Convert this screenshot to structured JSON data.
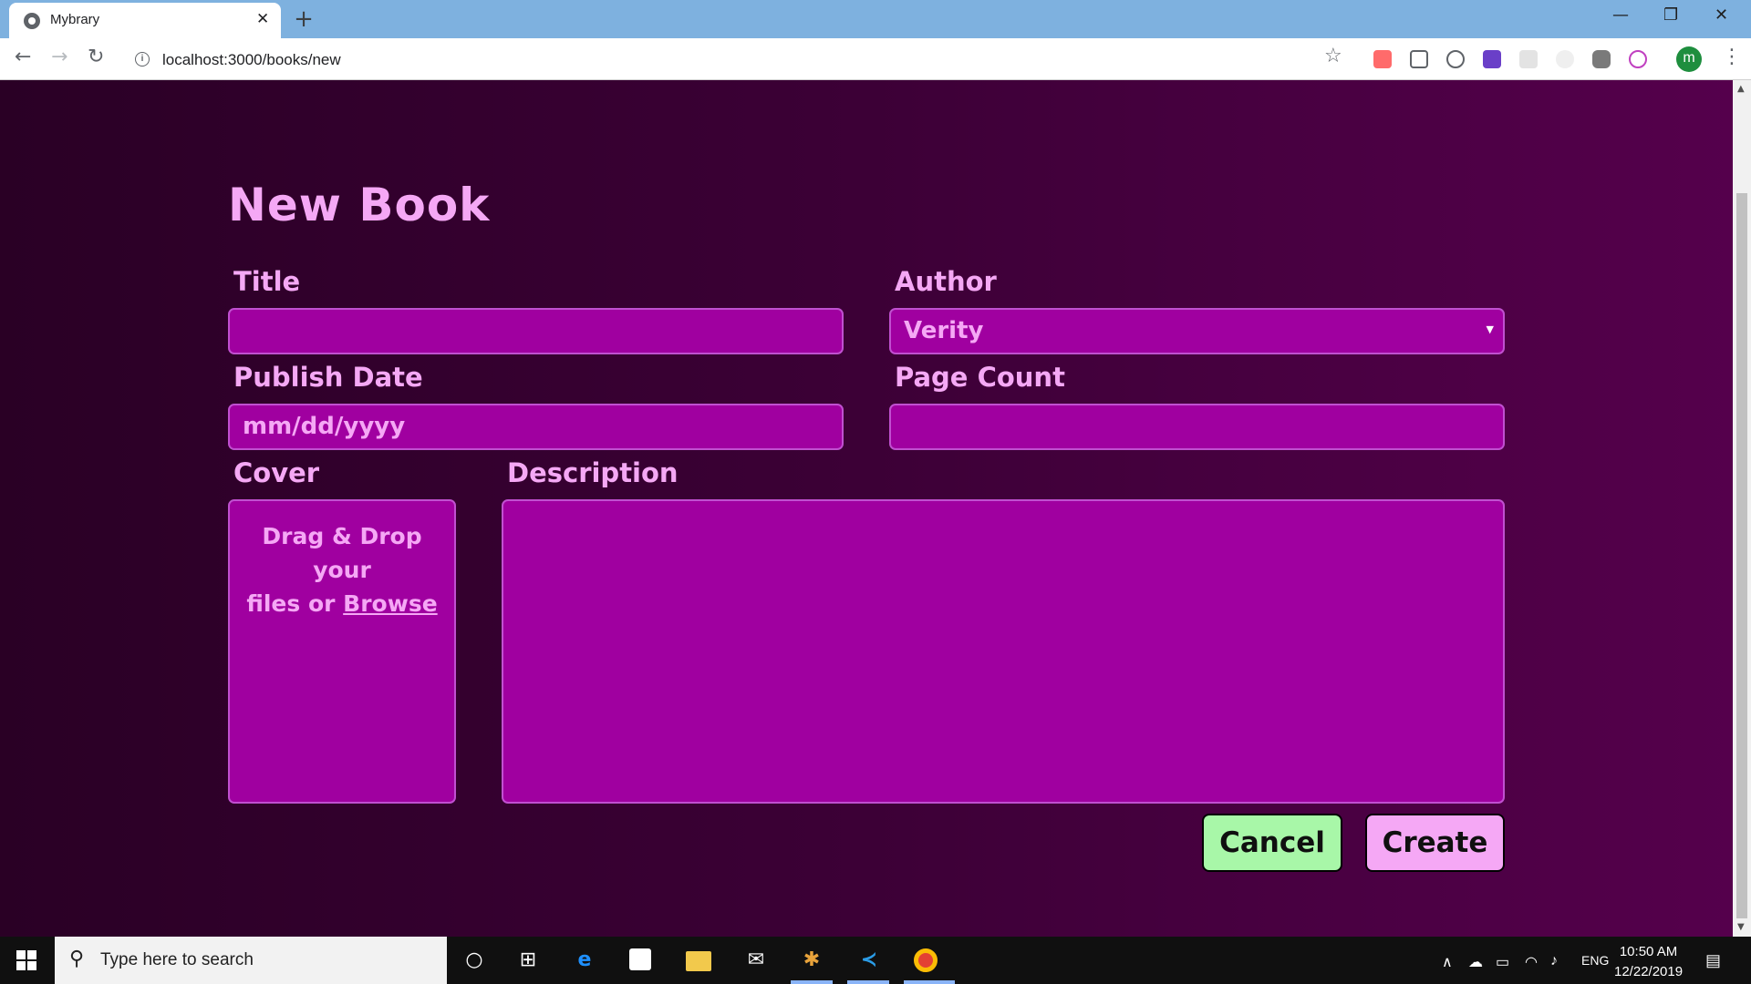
{
  "browser": {
    "tab_title": "Mybrary",
    "tab_close": "✕",
    "new_tab": "+",
    "url": "localhost:3000/books/new",
    "profile_initial": "m",
    "window_controls": {
      "minimize": "—",
      "restore": "❐",
      "close": "✕"
    }
  },
  "form": {
    "heading": "New Book",
    "title_label": "Title",
    "title_value": "",
    "author_label": "Author",
    "author_value": "Verity",
    "publish_date_label": "Publish Date",
    "publish_date_placeholder": "mm/dd/yyyy",
    "page_count_label": "Page Count",
    "page_count_value": "",
    "cover_label": "Cover",
    "dropzone_text_1": "Drag & Drop your",
    "dropzone_text_2": "files or ",
    "dropzone_browse": "Browse",
    "description_label": "Description",
    "description_value": "",
    "cancel_label": "Cancel",
    "create_label": "Create"
  },
  "colors": {
    "text_pink": "#f5a8f5",
    "field_bg": "#a000a0",
    "cancel_bg": "#a8f7a8",
    "create_bg": "#f5a8f5"
  },
  "taskbar": {
    "search_placeholder": "Type here to search",
    "language": "ENG",
    "time": "10:50 AM",
    "date": "12/22/2019"
  }
}
